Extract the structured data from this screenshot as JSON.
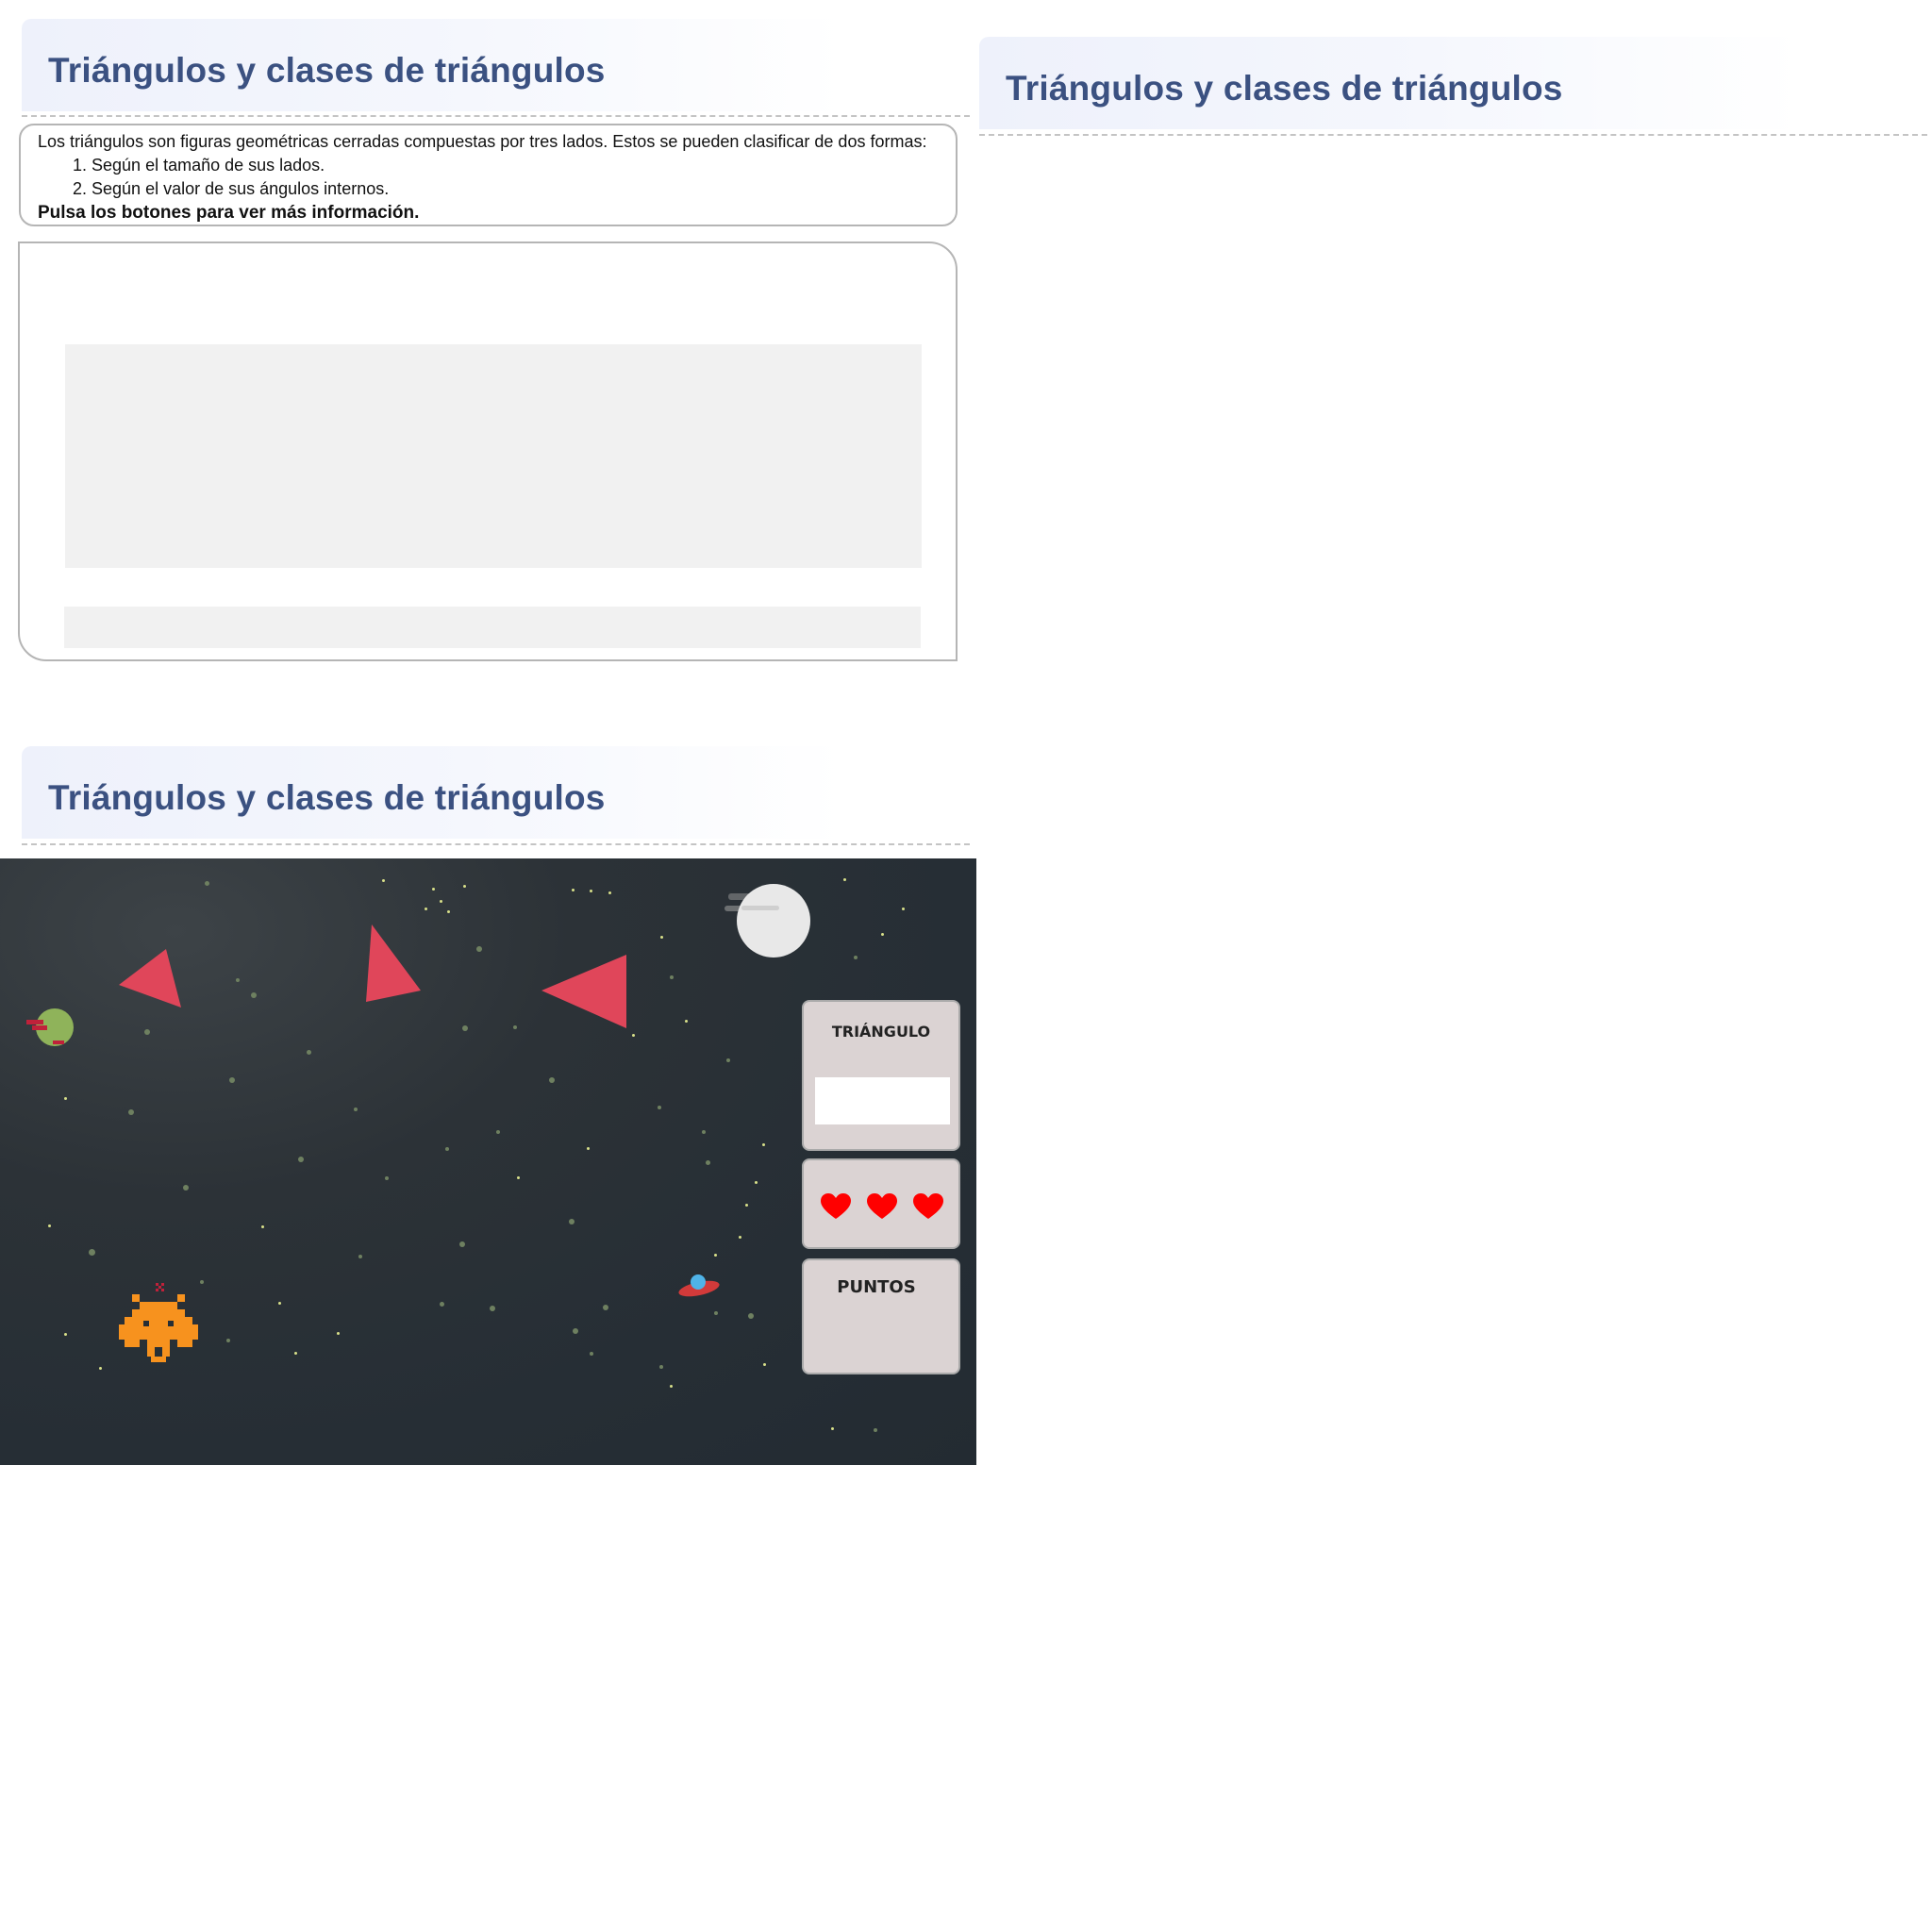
{
  "sections": [
    {
      "title": "Triángulos y clases de triángulos"
    },
    {
      "title": "Triángulos y clases de triángulos"
    },
    {
      "title": "Triángulos y clases de triángulos"
    }
  ],
  "info": {
    "intro": "Los triángulos son figuras geométricas cerradas compuestas por tres lados. Estos se pueden clasificar de dos formas:",
    "items": [
      "1. Según el tamaño de sus lados.",
      "2. Según el valor de sus ángulos internos."
    ],
    "instruction": "Pulsa los botones para ver más información."
  },
  "game": {
    "triangle_label": "TRIÁNGULO",
    "lives": 3,
    "points_label": "PUNTOS",
    "colors": {
      "background": "#262e35",
      "triangle": "#e0465a",
      "panel": "#dbd3d3",
      "heart": "#ff0000",
      "invader": "#f7921e"
    },
    "icons": [
      "triangle-target-icon",
      "moon-icon",
      "green-planet-icon",
      "ufo-icon",
      "space-invader-icon",
      "heart-icon"
    ]
  }
}
